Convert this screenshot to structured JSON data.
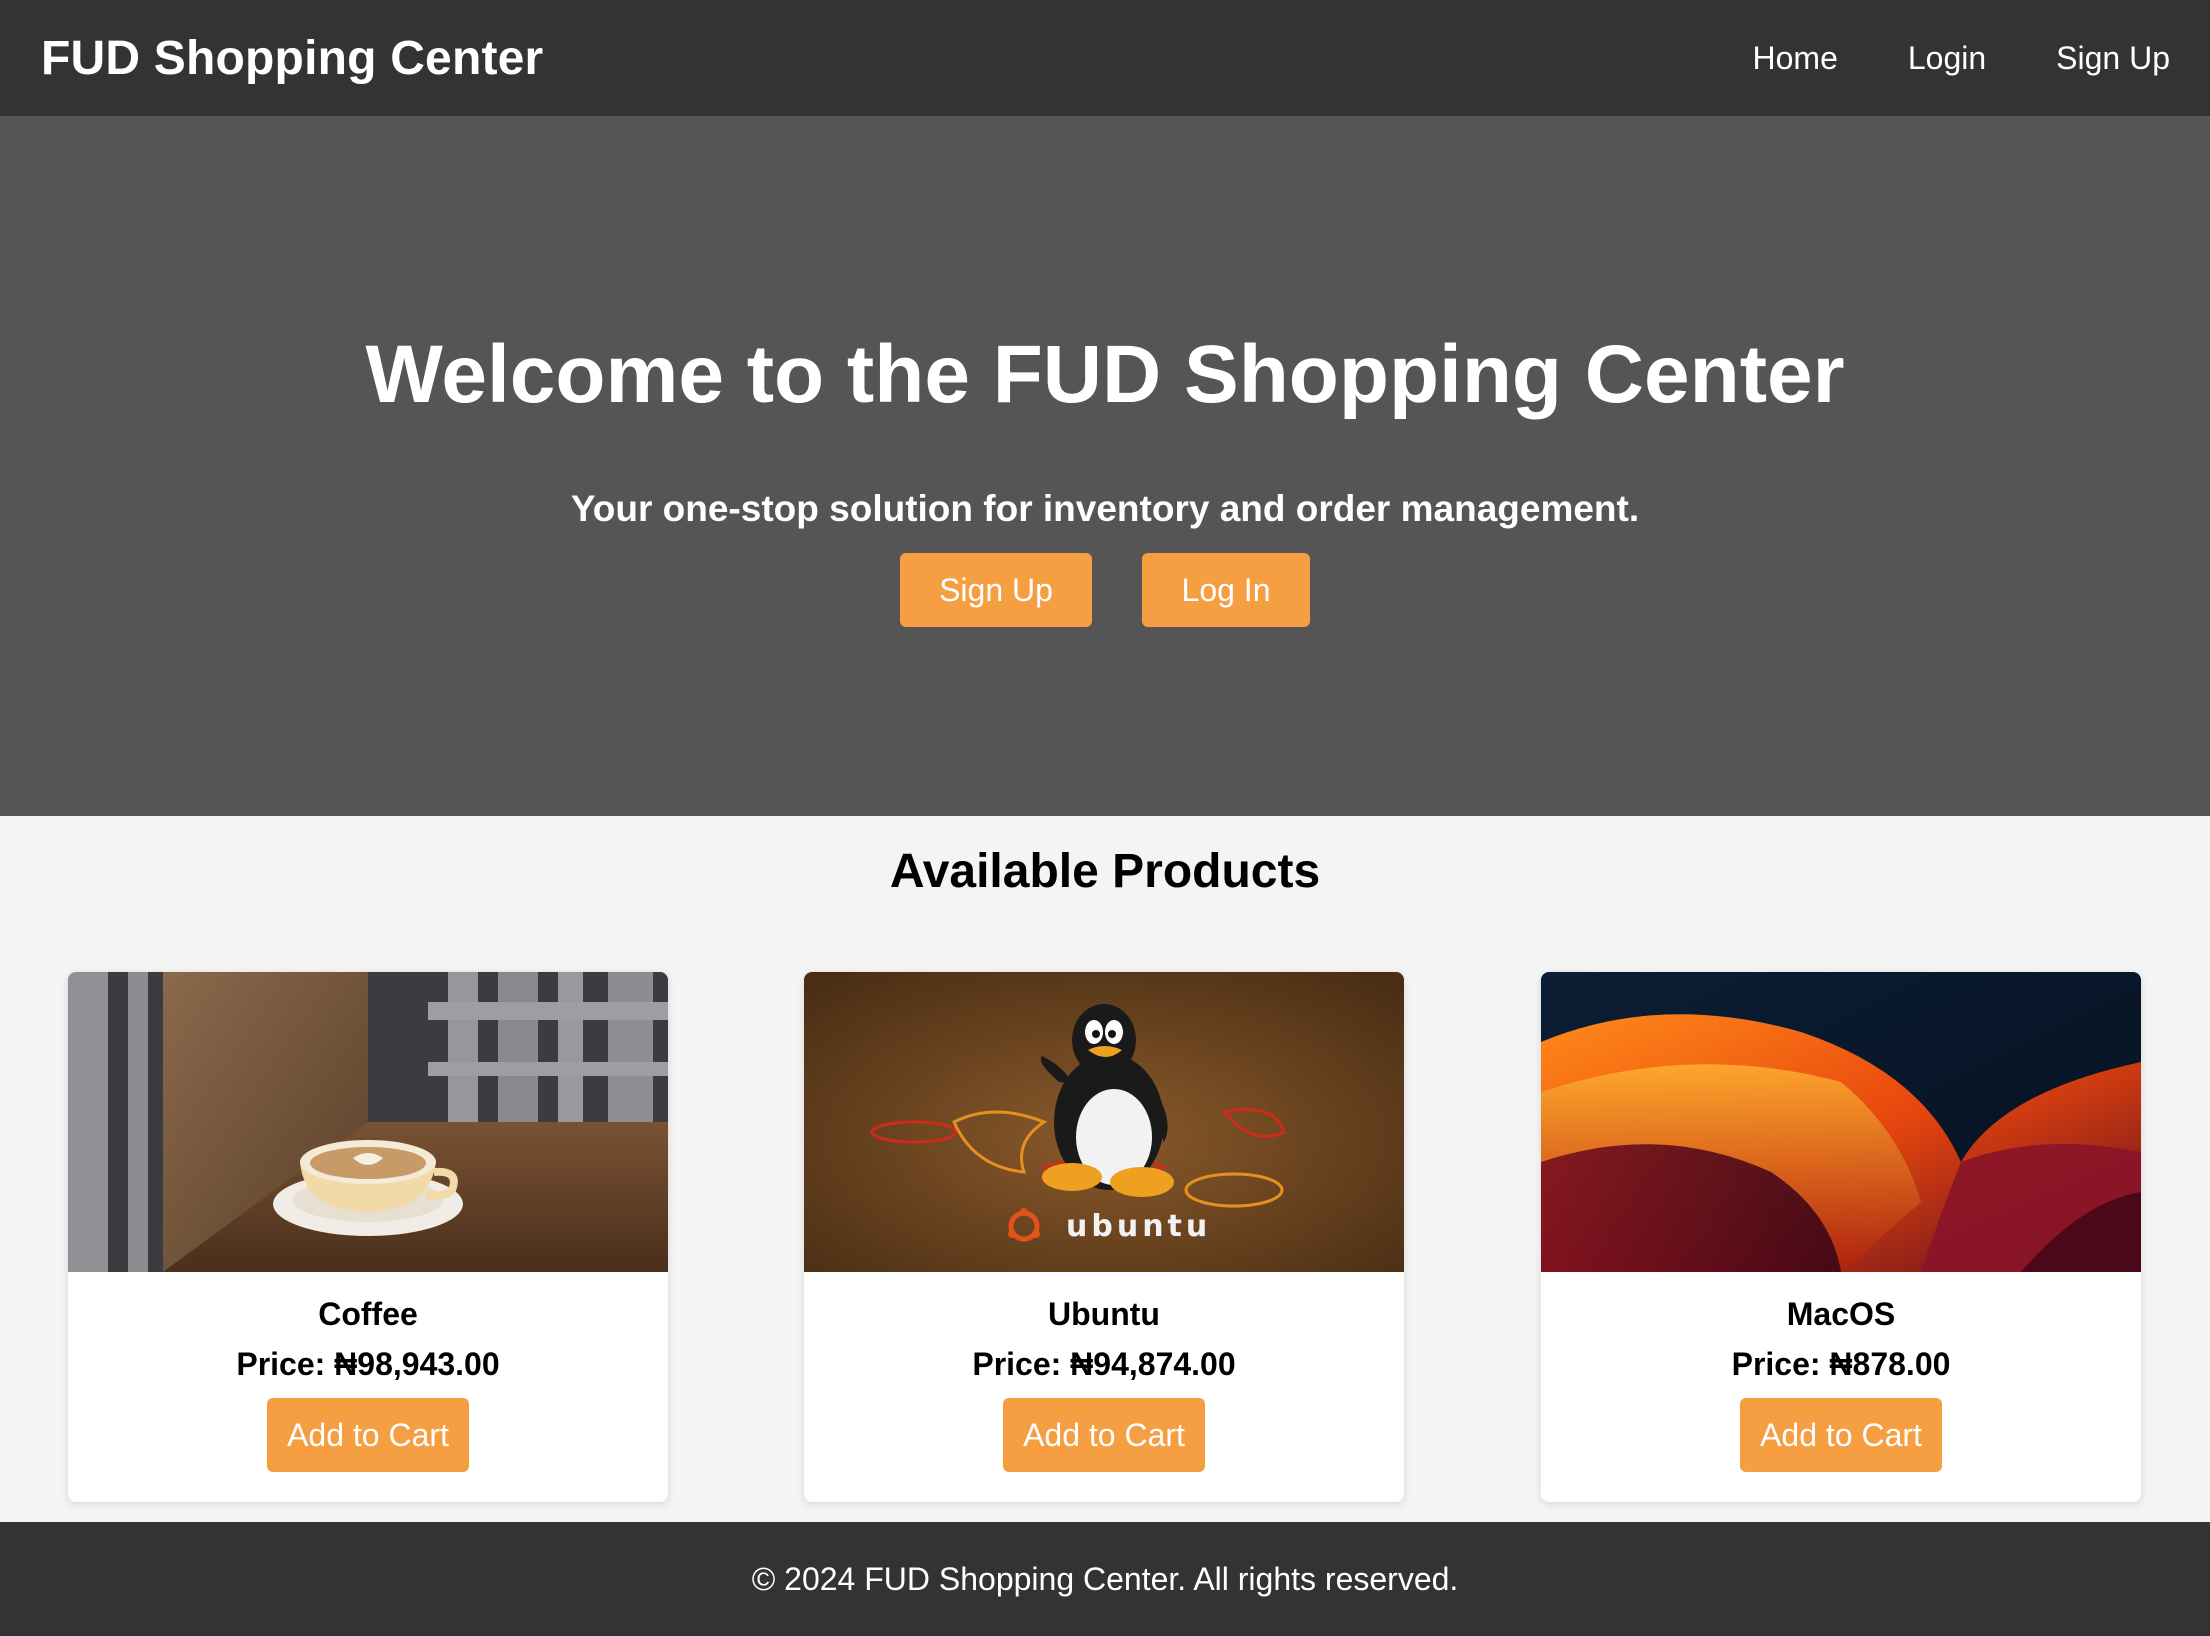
{
  "header": {
    "brand": "FUD Shopping Center",
    "nav": {
      "home": "Home",
      "login": "Login",
      "signup": "Sign Up"
    }
  },
  "hero": {
    "title": "Welcome to the FUD Shopping Center",
    "tagline": "Your one-stop solution for inventory and order management.",
    "signup_label": "Sign Up",
    "login_label": "Log In"
  },
  "products": {
    "title": "Available Products",
    "items": [
      {
        "name": "Coffee",
        "price": "Price: ₦98,943.00",
        "button": "Add to Cart"
      },
      {
        "name": "Ubuntu",
        "price": "Price: ₦94,874.00",
        "button": "Add to Cart",
        "image_text": "ubuntu"
      },
      {
        "name": "MacOS",
        "price": "Price: ₦878.00",
        "button": "Add to Cart"
      }
    ]
  },
  "footer": {
    "text": "© 2024 FUD Shopping Center. All rights reserved."
  },
  "colors": {
    "header_bg": "#333333",
    "hero_bg": "#555555",
    "accent": "#f59e42",
    "page_bg": "#f4f4f4"
  }
}
